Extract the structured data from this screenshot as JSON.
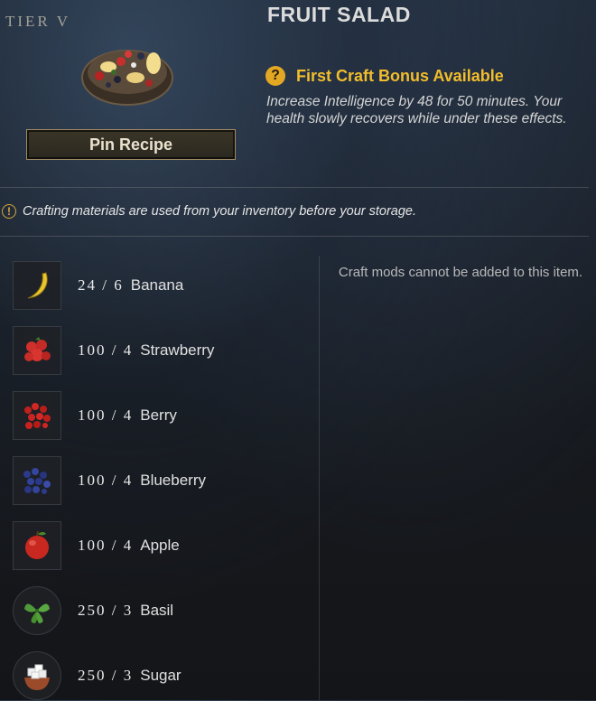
{
  "header": {
    "tier_label": "TIER V",
    "title": "FRUIT SALAD",
    "pin_button": "Pin Recipe"
  },
  "bonus": {
    "icon": "question-icon",
    "title": "First Craft Bonus Available",
    "description": "Increase Intelligence by 48 for 50 minutes. Your health slowly recovers while under these effects."
  },
  "notice": {
    "icon": "exclamation-icon",
    "text": "Crafting materials are used from your inventory before your storage."
  },
  "mods_note": "Craft mods cannot be added to this item.",
  "materials": [
    {
      "have": "24",
      "need": "6",
      "name": "Banana",
      "icon": "banana-icon"
    },
    {
      "have": "100",
      "need": "4",
      "name": "Strawberry",
      "icon": "strawberry-icon"
    },
    {
      "have": "100",
      "need": "4",
      "name": "Berry",
      "icon": "berry-icon"
    },
    {
      "have": "100",
      "need": "4",
      "name": "Blueberry",
      "icon": "blueberry-icon"
    },
    {
      "have": "100",
      "need": "4",
      "name": "Apple",
      "icon": "apple-icon"
    },
    {
      "have": "250",
      "need": "3",
      "name": "Basil",
      "icon": "basil-icon"
    },
    {
      "have": "250",
      "need": "3",
      "name": "Sugar",
      "icon": "sugar-icon"
    }
  ],
  "colors": {
    "bonus_accent": "#f2bd2c",
    "button_border": "#a08b63"
  }
}
